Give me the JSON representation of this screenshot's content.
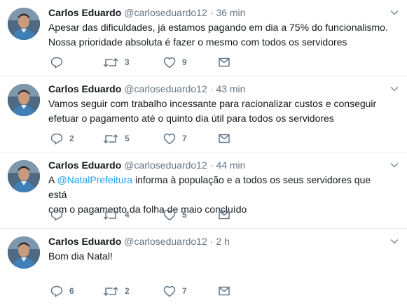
{
  "tweets": [
    {
      "name": "Carlos Eduardo",
      "handle": "@carloseduardo12",
      "time": "36 min",
      "text_parts": [
        "Apesar das dificuldades, já estamos pagando em dia a 75% do funcionalismo.",
        "Nossa prioridade absoluta é fazer o mesmo com todos os servidores"
      ],
      "replies": "",
      "retweets": "3",
      "likes": "9"
    },
    {
      "name": "Carlos Eduardo",
      "handle": "@carloseduardo12",
      "time": "43 min",
      "text_parts": [
        "Vamos seguir com trabalho incessante para racionalizar custos e conseguir",
        "efetuar o pagamento até o quinto dia útil para todos os servidores"
      ],
      "replies": "2",
      "retweets": "5",
      "likes": "7"
    },
    {
      "name": "Carlos Eduardo",
      "handle": "@carloseduardo12",
      "time": "44 min",
      "text_prefix": "A ",
      "mention": "@NatalPrefeitura",
      "text_suffix": " informa à população e a todos os seus servidores que está",
      "text_line2": "com o pagamento da folha de maio concluído",
      "replies": "",
      "retweets": "4",
      "likes": "5"
    },
    {
      "name": "Carlos Eduardo",
      "handle": "@carloseduardo12",
      "time": "2 h",
      "text_parts": [
        "Bom dia Natal!"
      ],
      "replies": "6",
      "retweets": "2",
      "likes": "7"
    }
  ],
  "separator": "·",
  "icons": {
    "reply": "reply-icon",
    "retweet": "retweet-icon",
    "like": "heart-icon",
    "dm": "envelope-icon",
    "menu": "chevron-down-icon"
  },
  "colors": {
    "text": "#14171a",
    "secondary": "#657786",
    "link": "#1da1f2",
    "border": "#e6ecf0"
  }
}
